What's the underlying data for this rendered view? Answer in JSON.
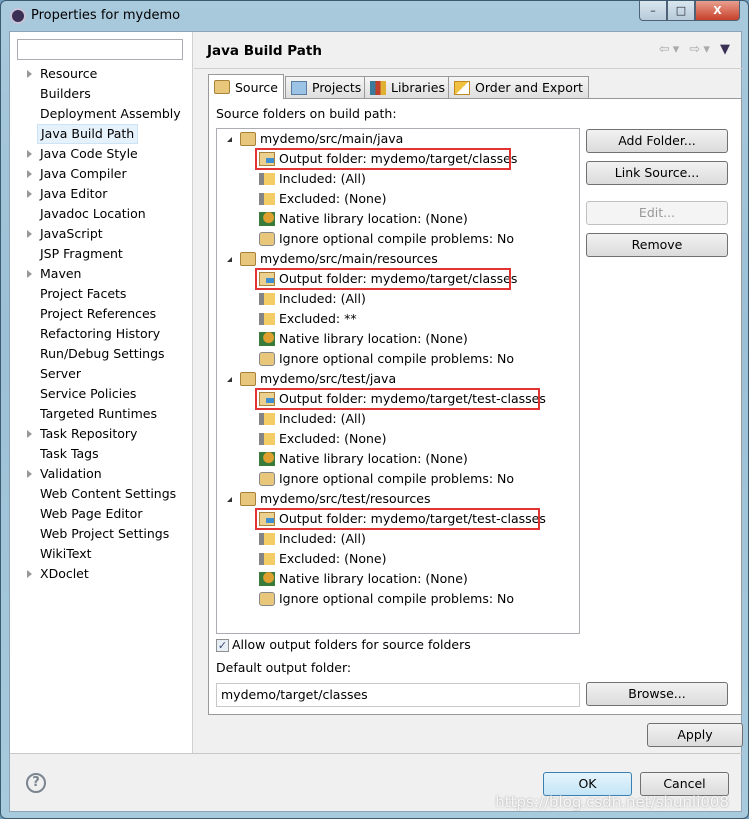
{
  "window": {
    "title": "Properties for mydemo",
    "minimize": "–",
    "maximize": "□",
    "close": "X"
  },
  "sidebar": {
    "filter_value": "",
    "items": [
      {
        "label": "Resource",
        "expandable": true
      },
      {
        "label": "Builders",
        "expandable": false
      },
      {
        "label": "Deployment Assembly",
        "expandable": false
      },
      {
        "label": "Java Build Path",
        "expandable": false,
        "selected": true
      },
      {
        "label": "Java Code Style",
        "expandable": true
      },
      {
        "label": "Java Compiler",
        "expandable": true
      },
      {
        "label": "Java Editor",
        "expandable": true
      },
      {
        "label": "Javadoc Location",
        "expandable": false
      },
      {
        "label": "JavaScript",
        "expandable": true
      },
      {
        "label": "JSP Fragment",
        "expandable": false
      },
      {
        "label": "Maven",
        "expandable": true
      },
      {
        "label": "Project Facets",
        "expandable": false
      },
      {
        "label": "Project References",
        "expandable": false
      },
      {
        "label": "Refactoring History",
        "expandable": false
      },
      {
        "label": "Run/Debug Settings",
        "expandable": false
      },
      {
        "label": "Server",
        "expandable": false
      },
      {
        "label": "Service Policies",
        "expandable": false
      },
      {
        "label": "Targeted Runtimes",
        "expandable": false
      },
      {
        "label": "Task Repository",
        "expandable": true
      },
      {
        "label": "Task Tags",
        "expandable": false
      },
      {
        "label": "Validation",
        "expandable": true
      },
      {
        "label": "Web Content Settings",
        "expandable": false
      },
      {
        "label": "Web Page Editor",
        "expandable": false
      },
      {
        "label": "Web Project Settings",
        "expandable": false
      },
      {
        "label": "WikiText",
        "expandable": false
      },
      {
        "label": "XDoclet",
        "expandable": true
      }
    ]
  },
  "header": {
    "title": "Java Build Path",
    "nav": {
      "back": "⇦",
      "forward": "⇨",
      "dropdown": "▾",
      "menu": "▼"
    }
  },
  "tabs": [
    {
      "label": "Source",
      "active": true
    },
    {
      "label": "Projects"
    },
    {
      "label": "Libraries"
    },
    {
      "label": "Order and Export"
    }
  ],
  "source": {
    "label": "Source folders on build path:",
    "folders": [
      {
        "name": "mydemo/src/main/java",
        "children": [
          "Output folder: mydemo/target/classes",
          "Included: (All)",
          "Excluded: (None)",
          "Native library location: (None)",
          "Ignore optional compile problems: No"
        ]
      },
      {
        "name": "mydemo/src/main/resources",
        "children": [
          "Output folder: mydemo/target/classes",
          "Included: (All)",
          "Excluded: **",
          "Native library location: (None)",
          "Ignore optional compile problems: No"
        ]
      },
      {
        "name": "mydemo/src/test/java",
        "children": [
          "Output folder: mydemo/target/test-classes",
          "Included: (All)",
          "Excluded: (None)",
          "Native library location: (None)",
          "Ignore optional compile problems: No"
        ]
      },
      {
        "name": "mydemo/src/test/resources",
        "children": [
          "Output folder: mydemo/target/test-classes",
          "Included: (All)",
          "Excluded: (None)",
          "Native library location: (None)",
          "Ignore optional compile problems: No"
        ]
      }
    ],
    "buttons": {
      "add_folder": "Add Folder...",
      "link_source": "Link Source...",
      "edit": "Edit...",
      "remove": "Remove"
    },
    "allow_output_label": "Allow output folders for source folders",
    "allow_output_checked": true,
    "default_output_label": "Default output folder:",
    "default_output_value": "mydemo/target/classes",
    "browse": "Browse..."
  },
  "apply": "Apply",
  "ok": "OK",
  "cancel": "Cancel",
  "help_icon": "?",
  "watermark": "https://blog.csdn.net/shunli008",
  "colors": {
    "highlight_box": "#e33333",
    "selection": "#e5f1fb"
  }
}
